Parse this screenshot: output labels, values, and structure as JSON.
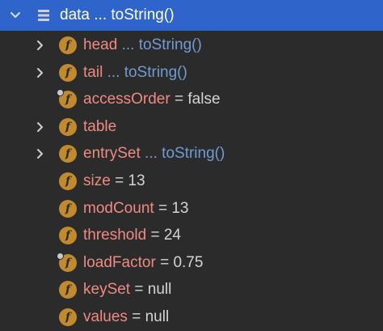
{
  "root": {
    "name": "data",
    "ellipsis": "...",
    "summary": "toString()",
    "expanded": true,
    "icon": "list-icon"
  },
  "fields": [
    {
      "name": "head",
      "ellipsis": "...",
      "summary": "toString()",
      "expandable": true,
      "final": false
    },
    {
      "name": "tail",
      "ellipsis": "...",
      "summary": "toString()",
      "expandable": true,
      "final": false
    },
    {
      "name": "accessOrder",
      "eq": "=",
      "value": "false",
      "expandable": false,
      "final": true
    },
    {
      "name": "table",
      "expandable": true,
      "final": false
    },
    {
      "name": "entrySet",
      "ellipsis": "...",
      "summary": "toString()",
      "expandable": true,
      "final": false
    },
    {
      "name": "size",
      "eq": "=",
      "value": "13",
      "expandable": false,
      "final": false
    },
    {
      "name": "modCount",
      "eq": "=",
      "value": "13",
      "expandable": false,
      "final": false
    },
    {
      "name": "threshold",
      "eq": "=",
      "value": "24",
      "expandable": false,
      "final": false
    },
    {
      "name": "loadFactor",
      "eq": "=",
      "value": "0.75",
      "expandable": false,
      "final": true
    },
    {
      "name": "keySet",
      "eq": "=",
      "value": "null",
      "expandable": false,
      "final": false
    },
    {
      "name": "values",
      "eq": "=",
      "value": "null",
      "expandable": false,
      "final": false
    }
  ],
  "field_icon_letter": "f",
  "colors": {
    "background": "#2b2b2b",
    "selection": "#2f65ca",
    "field_name": "#ef8a82",
    "summary": "#6f9bd6",
    "field_icon": "#c18a2f"
  }
}
